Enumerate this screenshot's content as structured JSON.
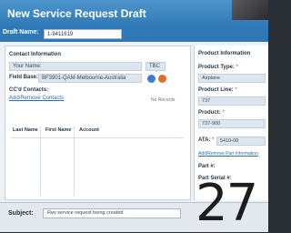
{
  "window": {
    "title": "New Service Request Draft"
  },
  "draft": {
    "label": "Draft Name:",
    "value": "1-9411619"
  },
  "contact": {
    "section_title": "Contact Information",
    "your_name_label": "Your Name:",
    "your_name_value": "TBC",
    "field_base_label": "Field Base:",
    "field_base_value": "BF3901-QAM-Melbourne-Australia",
    "cc_title": "CC'd Contacts:",
    "add_remove_link": "Add/Remove Contacts",
    "no_records": "No Records",
    "columns": [
      "Last Name",
      "First Name",
      "Account"
    ]
  },
  "product": {
    "section_title": "Product Information",
    "type_label": "Product Type:",
    "type_value": "Airplane",
    "line_label": "Product Line:",
    "line_value": "737",
    "product_label": "Product:",
    "product_value": "737-900",
    "ata_label": "ATA:",
    "ata_value": "5410-00",
    "part_link": "Add/Remove Part Information",
    "part_no_label": "Part #:",
    "part_serial_label": "Part Serial #:",
    "required_mark": "*"
  },
  "subject": {
    "label": "Subject:",
    "value": "Rev service request being created"
  },
  "overlay": {
    "number": "27"
  },
  "colors": {
    "title_bar": "#2f78b6",
    "panel_bg": "#ffffff",
    "field_bg": "#dde5ee"
  }
}
